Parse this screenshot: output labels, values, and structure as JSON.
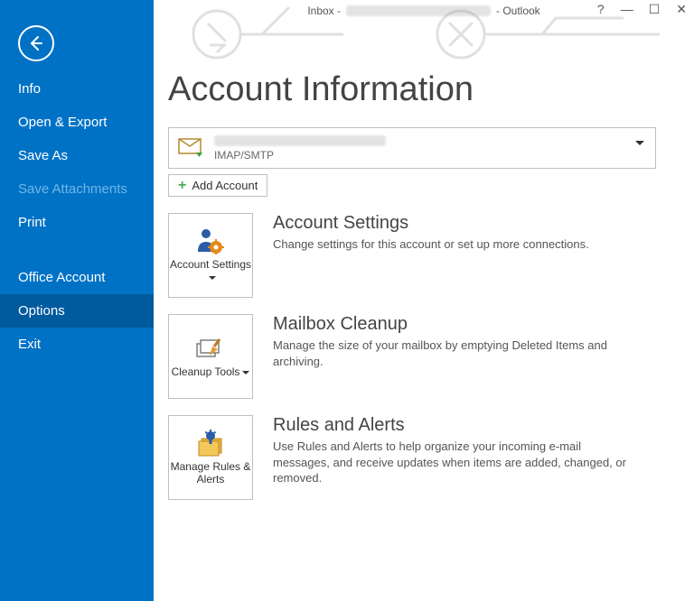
{
  "titlebar": {
    "prefix": "Inbox - ",
    "suffix": " - Outlook"
  },
  "sidebar": {
    "items": [
      {
        "label": "Info"
      },
      {
        "label": "Open & Export"
      },
      {
        "label": "Save As"
      },
      {
        "label": "Save Attachments"
      },
      {
        "label": "Print"
      },
      {
        "label": "Office Account"
      },
      {
        "label": "Options"
      },
      {
        "label": "Exit"
      }
    ]
  },
  "main": {
    "heading": "Account Information",
    "account": {
      "type": "IMAP/SMTP"
    },
    "add_account_label": "Add Account",
    "sections": [
      {
        "btn_label": "Account Settings",
        "title": "Account Settings",
        "desc": "Change settings for this account or set up more connections."
      },
      {
        "btn_label": "Cleanup Tools",
        "title": "Mailbox Cleanup",
        "desc": "Manage the size of your mailbox by emptying Deleted Items and archiving."
      },
      {
        "btn_label": "Manage Rules & Alerts",
        "title": "Rules and Alerts",
        "desc": "Use Rules and Alerts to help organize your incoming e-mail messages, and receive updates when items are added, changed, or removed."
      }
    ]
  }
}
